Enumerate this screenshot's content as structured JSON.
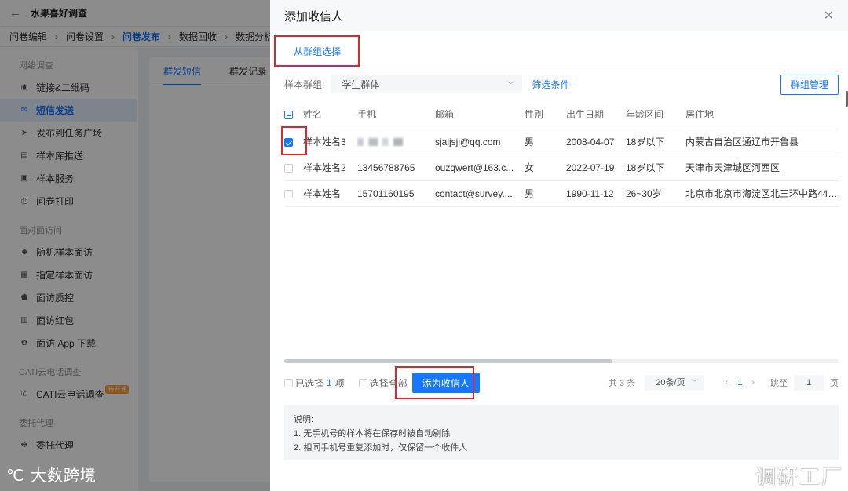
{
  "app": {
    "title": "水果喜好调查",
    "breadcrumbs": [
      "问卷编辑",
      "问卷设置",
      "问卷发布",
      "数据回收",
      "数据分析"
    ],
    "active_crumb": "问卷发布",
    "sidebar": {
      "group1": "网络调查",
      "group1_items": [
        {
          "label": "链接&二维码",
          "icon": "eye-icon",
          "glyph": "◉"
        },
        {
          "label": "短信发送",
          "icon": "chat-icon",
          "glyph": "✉"
        },
        {
          "label": "发布到任务广场",
          "icon": "send-icon",
          "glyph": "➤"
        },
        {
          "label": "样本库推送",
          "icon": "database-icon",
          "glyph": "▤"
        },
        {
          "label": "样本服务",
          "icon": "service-icon",
          "glyph": "▣"
        },
        {
          "label": "问卷打印",
          "icon": "print-icon",
          "glyph": "⎙"
        }
      ],
      "group2": "面对面访问",
      "group2_items": [
        {
          "label": "随机样本面访",
          "icon": "user-random-icon",
          "glyph": "☻"
        },
        {
          "label": "指定样本面访",
          "icon": "clipboard-icon",
          "glyph": "▦"
        },
        {
          "label": "面访质控",
          "icon": "shield-icon",
          "glyph": "⬟"
        },
        {
          "label": "面访红包",
          "icon": "redpacket-icon",
          "glyph": "▥"
        },
        {
          "label": "面访 App 下载",
          "icon": "android-icon",
          "glyph": "✿"
        }
      ],
      "group3": "CATI云电话调查",
      "group3_items": [
        {
          "label": "CATI云电话调查",
          "icon": "phone-icon",
          "glyph": "✆",
          "badge": "待开通"
        }
      ],
      "group4": "委托代理",
      "group4_items": [
        {
          "label": "委托代理",
          "icon": "handshake-icon",
          "glyph": "✤"
        }
      ]
    },
    "main_tabs": [
      "群发短信",
      "群发记录"
    ]
  },
  "modal": {
    "title": "添加收信人",
    "tab": "从群组选择",
    "filter_label": "样本群组:",
    "group_select": "学生群体",
    "filter_link": "筛选条件",
    "manage_button": "群组管理",
    "columns": [
      "姓名",
      "手机",
      "邮箱",
      "性别",
      "出生日期",
      "年龄区间",
      "居住地"
    ],
    "rows": [
      {
        "checked": true,
        "name": "样本姓名3",
        "phone": "",
        "phone_blurred": true,
        "email": "sjaijsji@qq.com",
        "gender": "男",
        "birth": "2008-04-07",
        "age": "18岁以下",
        "address": "内蒙古自治区通辽市开鲁县"
      },
      {
        "checked": false,
        "name": "样本姓名2",
        "phone": "13456788765",
        "phone_blurred": false,
        "email": "ouzqwert@163.c...",
        "gender": "女",
        "birth": "2022-07-19",
        "age": "18岁以下",
        "address": "天津市天津城区河西区"
      },
      {
        "checked": false,
        "name": "样本姓名",
        "phone": "15701160195",
        "phone_blurred": false,
        "email": "contact@survey....",
        "gender": "男",
        "birth": "1990-11-12",
        "age": "26~30岁",
        "address": "北京市北京市海淀区北三环中路44号..."
      }
    ],
    "footer": {
      "selected_prefix": "已选择",
      "selected_count": "1",
      "selected_suffix": "项",
      "select_all": "选择全部",
      "add_button": "添为收信人",
      "total": "共 3 条",
      "page_size": "20条/页",
      "prev": "‹",
      "current_page": "1",
      "next": "›",
      "jump_label": "跳至",
      "jump_value": "1",
      "page_suffix": "页"
    },
    "notes": {
      "title": "说明:",
      "line1": "1. 无手机号的样本将在保存时被自动剔除",
      "line2": "2. 相同手机号重复添加时，仅保留一个收件人"
    }
  },
  "watermarks": {
    "left": "大数跨境",
    "left_logo": "℃",
    "right": "调研工厂"
  },
  "colors": {
    "accent": "#1677ff",
    "highlight": "#e0262d"
  }
}
